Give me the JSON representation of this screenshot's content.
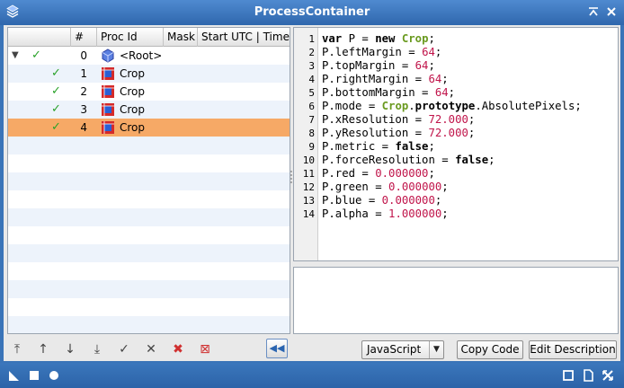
{
  "window": {
    "title": "ProcessContainer"
  },
  "list": {
    "columns": [
      "#",
      "Proc Id",
      "Mask",
      "Start UTC | Time"
    ],
    "rows": [
      {
        "index": "0",
        "proc_id": "<Root>",
        "checked": "✓",
        "expanded": "▼",
        "icon": "root-process-icon"
      },
      {
        "index": "1",
        "proc_id": "Crop",
        "checked": "✓",
        "icon": "crop-process-icon"
      },
      {
        "index": "2",
        "proc_id": "Crop",
        "checked": "✓",
        "icon": "crop-process-icon"
      },
      {
        "index": "3",
        "proc_id": "Crop",
        "checked": "✓",
        "icon": "crop-process-icon"
      },
      {
        "index": "4",
        "proc_id": "Crop",
        "checked": "✓",
        "icon": "crop-process-icon",
        "selected": true
      }
    ]
  },
  "toolbar": {
    "move_to_top": "⤒",
    "move_up": "↑",
    "move_down": "↓",
    "move_to_bottom": "⤓",
    "enable": "✓",
    "disable": "✕",
    "delete": "✖",
    "delete_all": "⊠",
    "collapse": "◀◀"
  },
  "editor": {
    "line_numbers": [
      "1",
      "2",
      "3",
      "4",
      "5",
      "6",
      "7",
      "8",
      "9",
      "10",
      "11",
      "12",
      "13",
      "14"
    ],
    "lines": [
      [
        {
          "t": "var",
          "c": "kw"
        },
        {
          "t": " P = "
        },
        {
          "t": "new",
          "c": "kw"
        },
        {
          "t": " "
        },
        {
          "t": "Crop",
          "c": "cls"
        },
        {
          "t": ";"
        }
      ],
      [
        {
          "t": "P.leftMargin = "
        },
        {
          "t": "64",
          "c": "str"
        },
        {
          "t": ";"
        }
      ],
      [
        {
          "t": "P.topMargin = "
        },
        {
          "t": "64",
          "c": "str"
        },
        {
          "t": ";"
        }
      ],
      [
        {
          "t": "P.rightMargin = "
        },
        {
          "t": "64",
          "c": "str"
        },
        {
          "t": ";"
        }
      ],
      [
        {
          "t": "P.bottomMargin = "
        },
        {
          "t": "64",
          "c": "str"
        },
        {
          "t": ";"
        }
      ],
      [
        {
          "t": "P.mode = "
        },
        {
          "t": "Crop",
          "c": "cls"
        },
        {
          "t": "."
        },
        {
          "t": "prototype",
          "c": "kw"
        },
        {
          "t": ".AbsolutePixels;"
        }
      ],
      [
        {
          "t": "P.xResolution = "
        },
        {
          "t": "72.000",
          "c": "str"
        },
        {
          "t": ";"
        }
      ],
      [
        {
          "t": "P.yResolution = "
        },
        {
          "t": "72.000",
          "c": "str"
        },
        {
          "t": ";"
        }
      ],
      [
        {
          "t": "P.metric = "
        },
        {
          "t": "false",
          "c": "kw"
        },
        {
          "t": ";"
        }
      ],
      [
        {
          "t": "P.forceResolution = "
        },
        {
          "t": "false",
          "c": "kw"
        },
        {
          "t": ";"
        }
      ],
      [
        {
          "t": "P.red = "
        },
        {
          "t": "0.000000",
          "c": "str"
        },
        {
          "t": ";"
        }
      ],
      [
        {
          "t": "P.green = "
        },
        {
          "t": "0.000000",
          "c": "str"
        },
        {
          "t": ";"
        }
      ],
      [
        {
          "t": "P.blue = "
        },
        {
          "t": "0.000000",
          "c": "str"
        },
        {
          "t": ";"
        }
      ],
      [
        {
          "t": "P.alpha = "
        },
        {
          "t": "1.000000",
          "c": "str"
        },
        {
          "t": ";"
        }
      ]
    ]
  },
  "controls": {
    "language": "JavaScript",
    "copy_code": "Copy Code",
    "edit_description": "Edit Description"
  },
  "colors": {
    "accent": "#3a74b8",
    "selected_row": "#f6a966",
    "check": "#2aa22a",
    "number": "#c0144a",
    "class": "#6a9a1f"
  }
}
